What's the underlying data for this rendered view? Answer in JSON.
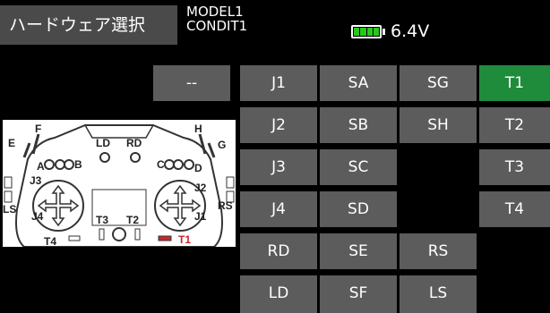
{
  "header": {
    "title": "ハードウェア選択",
    "model_line1": "MODEL1",
    "model_line2": "CONDIT1",
    "battery_icon": "battery-icon",
    "battery_level": 1.0,
    "voltage": "6.4V"
  },
  "colors": {
    "button": "#5c5c5c",
    "selected": "#1f8c3c",
    "header_box": "#4a4a4a"
  },
  "buttons": {
    "none": "--",
    "J1": "J1",
    "SA": "SA",
    "SG": "SG",
    "T1": "T1",
    "J2": "J2",
    "SB": "SB",
    "SH": "SH",
    "T2": "T2",
    "J3": "J3",
    "SC": "SC",
    "T3": "T3",
    "J4": "J4",
    "SD": "SD",
    "T4": "T4",
    "RD": "RD",
    "SE": "SE",
    "RS": "RS",
    "LD": "LD",
    "SF": "SF",
    "LS": "LS"
  },
  "diagram": {
    "labels": {
      "F": "F",
      "H": "H",
      "E": "E",
      "G": "G",
      "LD": "LD",
      "RD": "RD",
      "A": "A",
      "B": "B",
      "C": "C",
      "D": "D",
      "J3": "J3",
      "J2": "J2",
      "J4": "J4",
      "J1": "J1",
      "LS": "LS",
      "RS": "RS",
      "T3": "T3",
      "T2": "T2",
      "T4": "T4",
      "T1": "T1"
    }
  }
}
